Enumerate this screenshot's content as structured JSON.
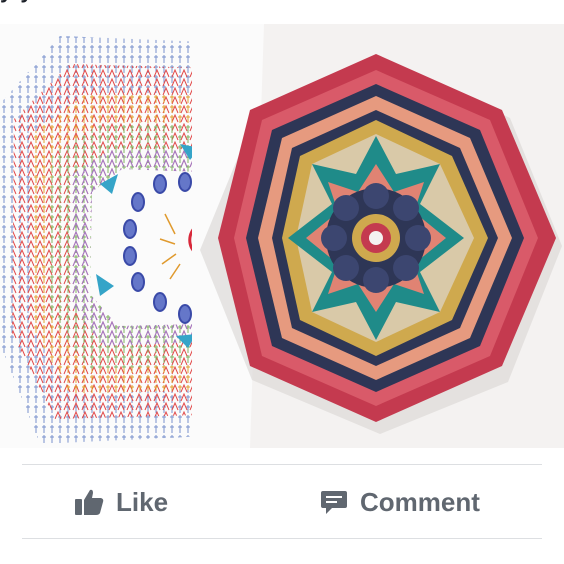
{
  "post": {
    "caption_fragment": "y y"
  },
  "actions": {
    "like_label": "Like",
    "comment_label": "Comment",
    "like_icon": "thumbs-up-icon",
    "comment_icon": "speech-bubble-icon"
  },
  "colors": {
    "action_text": "#606770",
    "divider": "#dddfe2",
    "yarn_red": "#c43a4f",
    "yarn_navy": "#2e3656",
    "yarn_salmon": "#e69a7f",
    "yarn_mustard": "#cfa94e",
    "yarn_teal": "#1f8b89"
  }
}
